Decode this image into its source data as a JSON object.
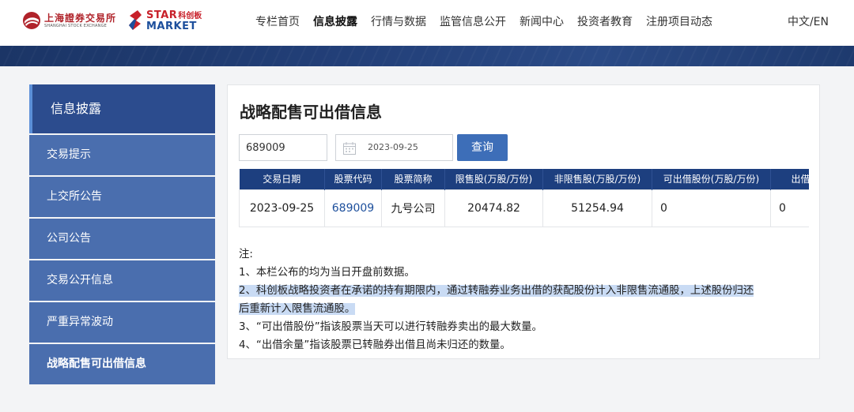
{
  "header": {
    "sse_logo_cn": "上海證券交易所",
    "sse_logo_en": "SHANGHAI STOCK EXCHANGE",
    "star_logo_en": "STAR",
    "star_logo_cn": "科创板",
    "star_logo_market": "MARKET",
    "nav": [
      "专栏首页",
      "信息披露",
      "行情与数据",
      "监管信息公开",
      "新闻中心",
      "投资者教育",
      "注册项目动态"
    ],
    "lang": "中文/EN"
  },
  "sidebar": {
    "title": "信息披露",
    "items": [
      "交易提示",
      "上交所公告",
      "公司公告",
      "交易公开信息",
      "严重异常波动",
      "战略配售可出借信息"
    ]
  },
  "main": {
    "title": "战略配售可出借信息",
    "search": {
      "code_value": "689009",
      "date_value": "2023-09-25",
      "query_label": "查询"
    },
    "table": {
      "headers": [
        "交易日期",
        "股票代码",
        "股票简称",
        "限售股(万股/万份)",
        "非限售股(万股/万份)",
        "可出借股份(万股/万份)",
        "出借余"
      ],
      "rows": [
        [
          "2023-09-25",
          "689009",
          "九号公司",
          "20474.82",
          "51254.94",
          "0",
          "0"
        ]
      ]
    },
    "notes": {
      "heading": "注:",
      "n1": "1、本栏公布的均为当日开盘前数据。",
      "n2a": "2、科创板战略投资者在承诺的持有期限内，通过转融券业务出借的获配股份计入非限售流通股，上述股份归还",
      "n2b": "后重新计入限售流通股。",
      "n3": "3、“可出借股份”指该股票当天可以进行转融券卖出的最大数量。",
      "n4": "4、“出借余量”指该股票已转融券出借且尚未归还的数量。"
    }
  },
  "colors": {
    "nav_dark": "#1d3f7f",
    "sidebar_head": "#2c4c8e",
    "sidebar_item": "#4a6eae",
    "button": "#3d6eb8",
    "highlight": "#c9dbf4",
    "sse_red": "#b0232a"
  }
}
